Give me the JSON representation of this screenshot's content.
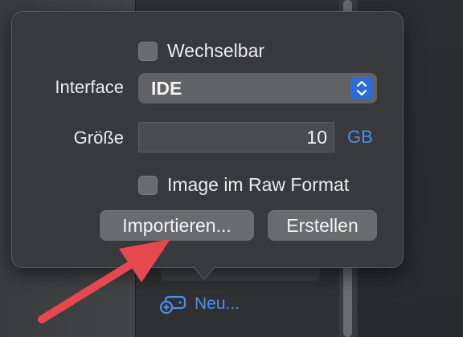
{
  "popover": {
    "removable_label": "Wechselbar",
    "interface_label": "Interface",
    "interface_value": "IDE",
    "size_label": "Größe",
    "size_value": "10",
    "size_unit": "GB",
    "raw_format_label": "Image im Raw Format",
    "import_button": "Importieren...",
    "create_button": "Erstellen"
  },
  "sidebar": {
    "new_label": "Neu..."
  },
  "colors": {
    "accent": "#4a8ff0",
    "stepper": "#2f6bd8",
    "annotation_arrow": "#e5484d"
  },
  "icons": {
    "new_drive": "hard-drive-plus-icon",
    "stepper": "up-down-chevron-icon"
  }
}
